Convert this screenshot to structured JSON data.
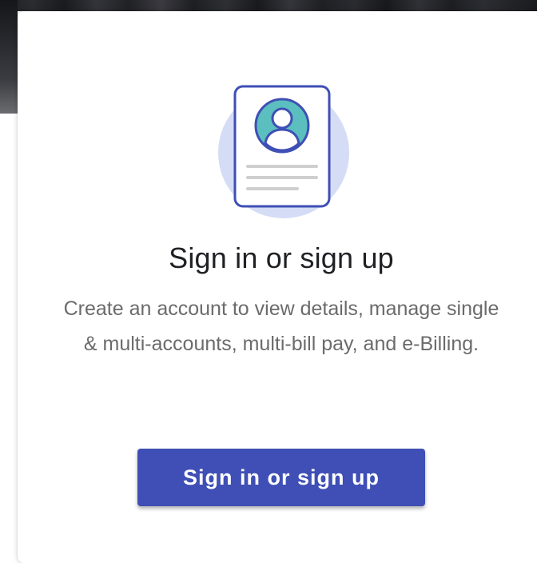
{
  "dialog": {
    "title": "Sign in or sign up",
    "description": "Create an account to view details, manage single & multi-accounts, multi-bill pay, and e-Billing.",
    "primary_button_label": "Sign in or sign up",
    "illustration_icon": "account-document-icon"
  },
  "colors": {
    "primary": "#3f4fb5",
    "avatar_fill": "#5bbfbf",
    "illustration_outline": "#3f4fb5",
    "illustration_bg": "#d5dcf5"
  }
}
